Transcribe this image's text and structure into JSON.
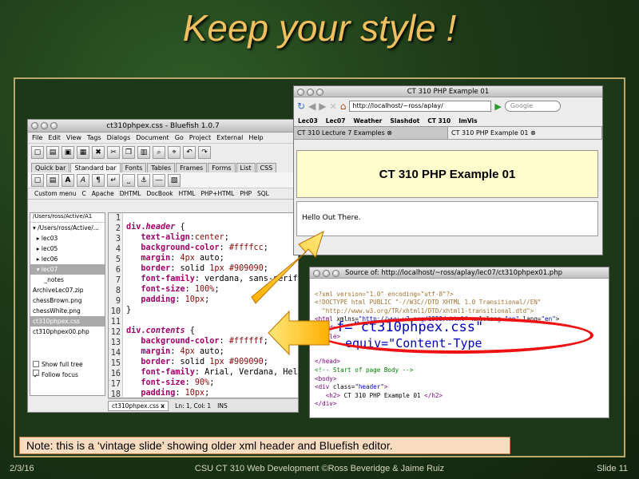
{
  "slide": {
    "title": "Keep your style !",
    "note": "Note: this is a ‘vintage slide’ showing older xml header and Bluefish editor.",
    "footer_date": "2/3/16",
    "footer_center": "CSU CT 310 Web Development ©Ross Beveridge & Jaime Ruiz",
    "footer_slide": "Slide 11"
  },
  "bluefish": {
    "window_title": "ct310phpex.css - Bluefish 1.0.7",
    "menu": [
      "File",
      "Edit",
      "View",
      "Tags",
      "Dialogs",
      "Document",
      "Go",
      "Project",
      "External",
      "Help"
    ],
    "tabs": [
      "Quick bar",
      "Standard bar",
      "Fonts",
      "Tables",
      "Frames",
      "Forms",
      "List",
      "CSS"
    ],
    "row3": [
      "Custom menu",
      "C",
      "Apache",
      "DHTML",
      "DocBook",
      "HTML",
      "PHP+HTML",
      "PHP",
      "SQL"
    ],
    "path": "/Users/ross/Active/A1",
    "tree": [
      "/Users/ross/Active/...",
      "lec03",
      "lec05",
      "lec06",
      "lec07",
      "_notes",
      "ArchiveLec07.zip",
      "chessBrown.png",
      "chessWhite.png",
      "ct310phpex.css",
      "ct310phpex00.php"
    ],
    "show_full_tree": "Show full tree",
    "follow_focus": "Follow focus",
    "line_numbers": [
      "1",
      "2",
      "3",
      "4",
      "5",
      "6",
      "7",
      "8",
      "9",
      "10",
      "11",
      "12",
      "13",
      "14",
      "15",
      "16",
      "17",
      "18"
    ],
    "file_tab": "ct310phpex.css",
    "status_pos": "Ln: 1, Col: 1",
    "status_ins": "INS"
  },
  "firefox": {
    "window_title": "CT 310 PHP Example 01",
    "url": "http://localhost/~ross/aplay/",
    "search_placeholder": "Google",
    "bookmarks": [
      "Lec03",
      "Lec07",
      "Weather",
      "Slashdot",
      "CT 310",
      "ImVis"
    ],
    "tab1": "CT 310 Lecture 7 Examples",
    "tab2": "CT 310 PHP Example 01",
    "page_heading": "CT 310 PHP Example 01",
    "page_body": "Hello Out There."
  },
  "source": {
    "window_title": "Source of: http://localhost/~ross/aplay/lec07/ct310phpex01.php",
    "magnified_line1": "f=\"ct310phpex.css\"",
    "magnified_line2": "equiv=\"Content-Type"
  }
}
